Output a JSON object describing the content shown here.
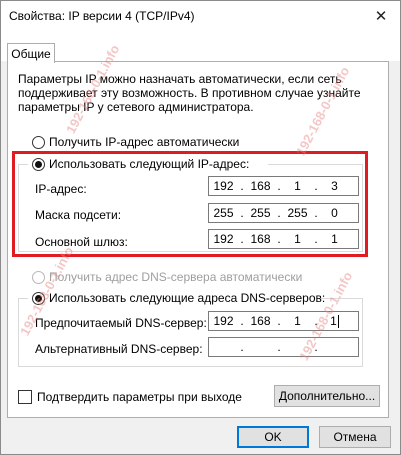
{
  "window": {
    "title": "Свойства: IP версии 4 (TCP/IPv4)",
    "close_glyph": "✕"
  },
  "tabs": [
    {
      "label": "Общие"
    }
  ],
  "description": "Параметры IP можно назначать автоматически, если сеть поддерживает эту возможность. В противном случае узнайте параметры IP у сетевого администратора.",
  "ip_section": {
    "auto_label": "Получить IP-адрес автоматически",
    "manual_label": "Использовать следующий IP-адрес:",
    "selected": "manual",
    "fields": [
      {
        "label": "IP-адрес:",
        "octets": [
          "192",
          "168",
          "1",
          "3"
        ]
      },
      {
        "label": "Маска подсети:",
        "octets": [
          "255",
          "255",
          "255",
          "0"
        ]
      },
      {
        "label": "Основной шлюз:",
        "octets": [
          "192",
          "168",
          "1",
          "1"
        ]
      }
    ]
  },
  "dns_section": {
    "auto_label": "Получить адрес DNS-сервера автоматически",
    "manual_label": "Использовать следующие адреса DNS-серверов:",
    "selected": "manual",
    "fields": [
      {
        "label": "Предпочитаемый DNS-сервер:",
        "octets": [
          "192",
          "168",
          "1",
          "1"
        ]
      },
      {
        "label": "Альтернативный DNS-сервер:",
        "octets": [
          "",
          "",
          "",
          ""
        ]
      }
    ]
  },
  "validate_label": "Подтвердить параметры при выходе",
  "advanced_label": "Дополнительно...",
  "ok_label": "OK",
  "cancel_label": "Отмена",
  "watermark_text": "192-168-0-1.info",
  "colors": {
    "highlight_box": "#e11b22",
    "accent": "#0078d7"
  }
}
